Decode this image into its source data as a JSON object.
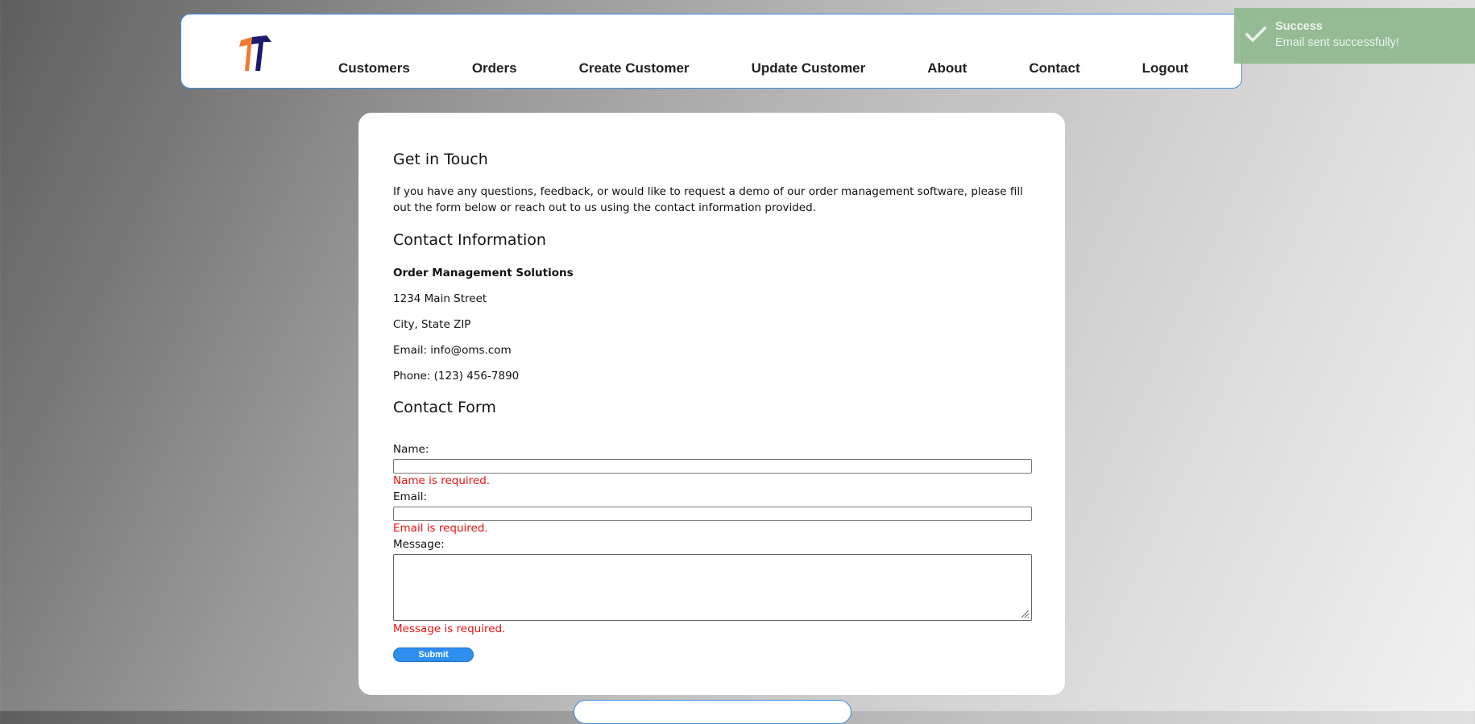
{
  "nav": {
    "items": [
      "Customers",
      "Orders",
      "Create Customer",
      "Update Customer",
      "About",
      "Contact",
      "Logout"
    ]
  },
  "contact": {
    "heading": "Get in Touch",
    "intro": "If you have any questions, feedback, or would like to request a demo of our order management software, please fill out the form below or reach out to us using the contact information provided.",
    "info_heading": "Contact Information",
    "company": "Order Management Solutions",
    "address": "1234 Main Street",
    "city": "City, State ZIP",
    "email": "Email: info@oms.com",
    "phone": "Phone: (123) 456-7890",
    "form_heading": "Contact Form"
  },
  "form": {
    "name_label": "Name:",
    "name_error": "Name is required.",
    "email_label": "Email:",
    "email_error": "Email is required.",
    "message_label": "Message:",
    "message_error": "Message is required.",
    "submit_label": "Submit",
    "name_value": "",
    "email_value": ""
  },
  "toast": {
    "title": "Success",
    "message": "Email sent successfully!",
    "icon": "check-icon",
    "color": "#8fb98f"
  },
  "colors": {
    "accent": "#2f8ff0",
    "error": "#ee1111",
    "logo_orange": "#f07a30",
    "logo_navy": "#1b1a6e"
  }
}
